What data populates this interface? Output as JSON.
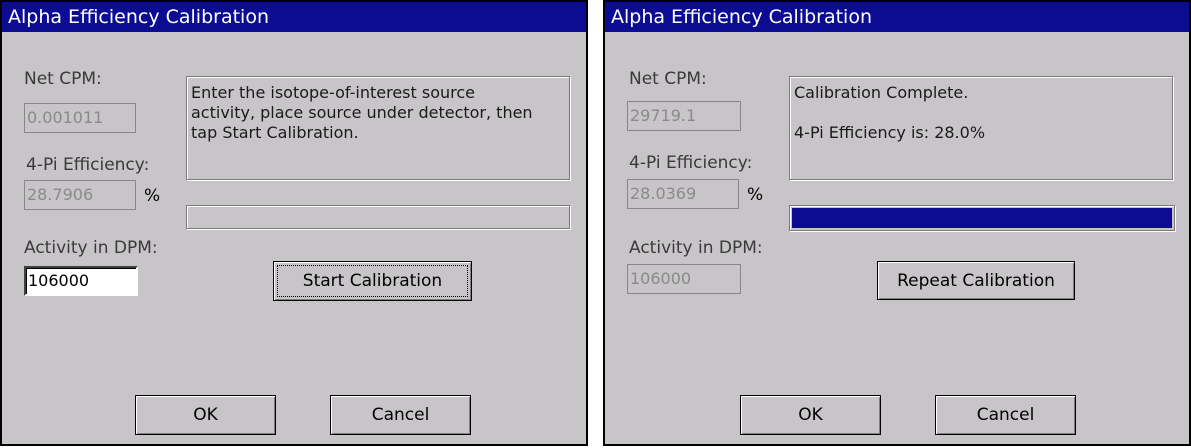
{
  "left_dialog": {
    "title": "Alpha Efficiency Calibration",
    "net_cpm_label": "Net CPM:",
    "net_cpm_value": "0.001011",
    "efficiency_label": "4-Pi Efficiency:",
    "efficiency_value": "28.7906",
    "percent_sign": "%",
    "activity_label": "Activity in DPM:",
    "activity_value": "106000",
    "message_lines": [
      "Enter the isotope-of-interest source",
      "activity, place source under detector, then",
      "tap Start Calibration."
    ],
    "progress": 0,
    "action_button": "Start Calibration",
    "ok_button": "OK",
    "cancel_button": "Cancel"
  },
  "right_dialog": {
    "title": "Alpha Efficiency Calibration",
    "net_cpm_label": "Net CPM:",
    "net_cpm_value": "29719.1",
    "efficiency_label": "4-Pi Efficiency:",
    "efficiency_value": "28.0369",
    "percent_sign": "%",
    "activity_label": "Activity in DPM:",
    "activity_value": "106000",
    "message_line_1": "Calibration Complete.",
    "message_line_2": "4-Pi Efficiency is:   28.0%",
    "progress": 1.0,
    "action_button": "Repeat Calibration",
    "ok_button": "OK",
    "cancel_button": "Cancel"
  },
  "colors": {
    "titlebar": "#0b0c92",
    "dialog_bg": "#c8c5c8",
    "progress_fill": "#0b0c92"
  }
}
